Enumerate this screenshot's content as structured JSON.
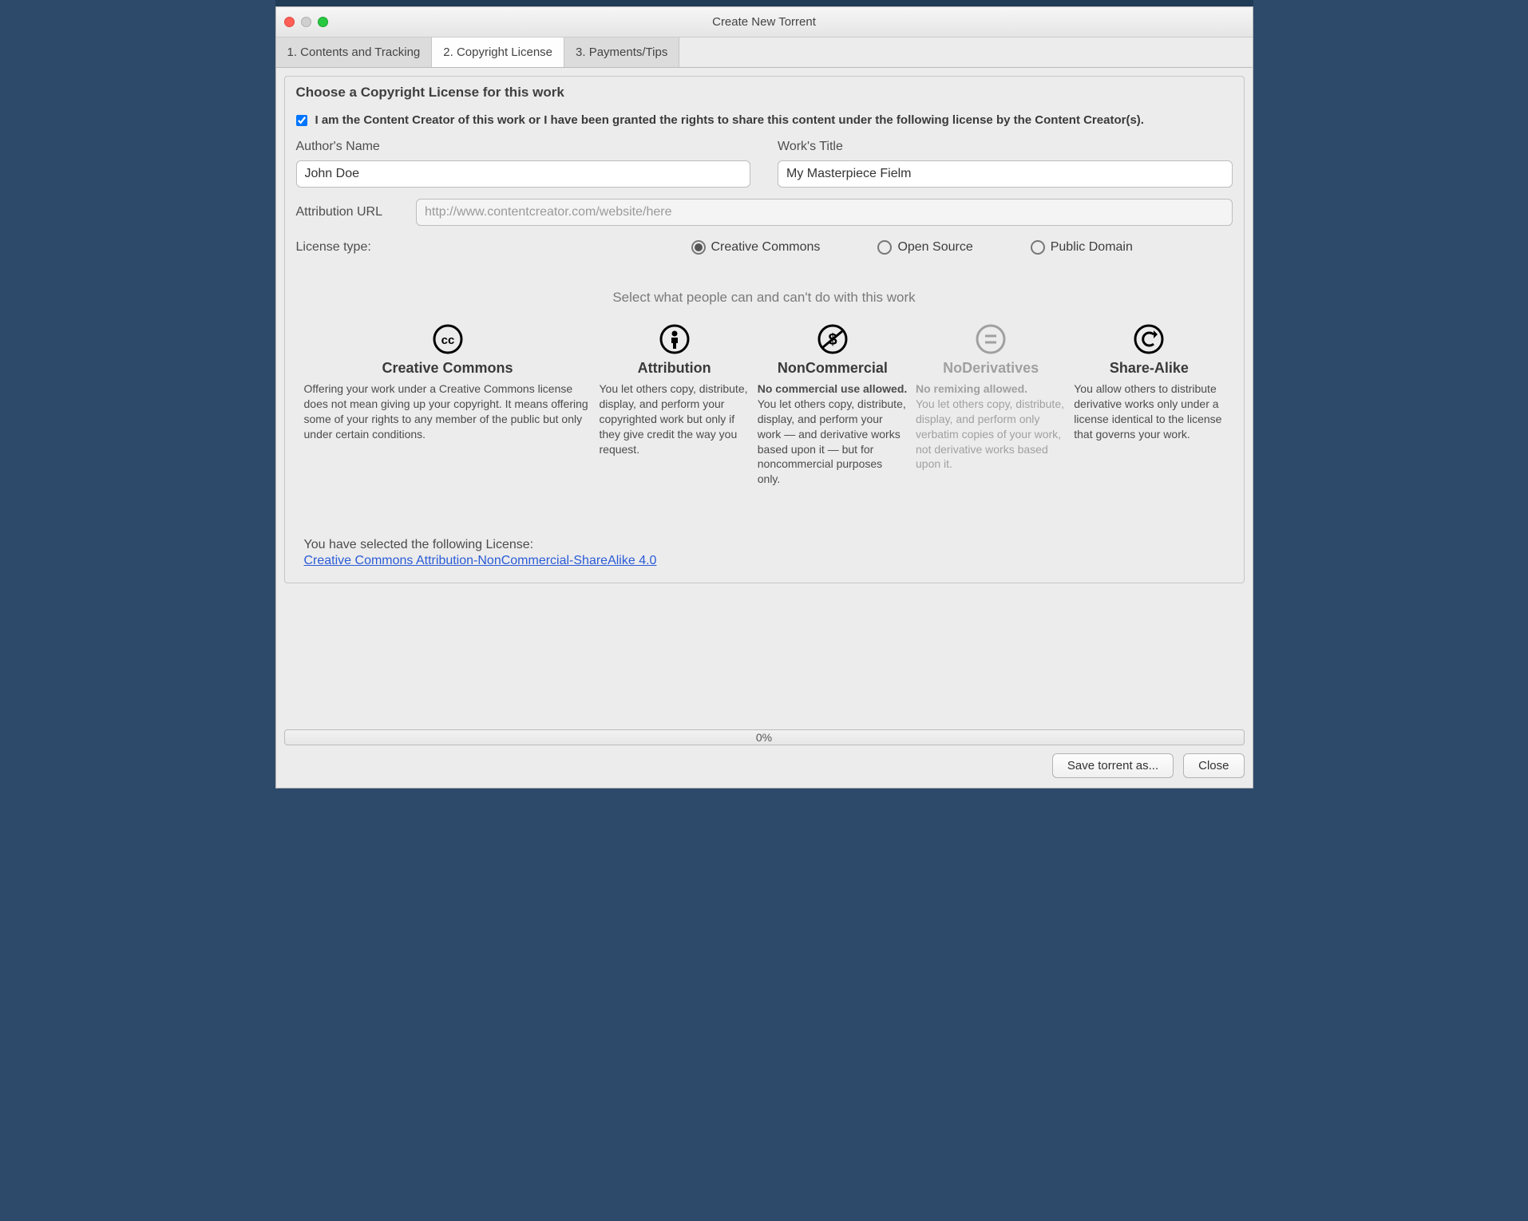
{
  "title": "Create New Torrent",
  "tabs": [
    {
      "label": "1. Contents and Tracking"
    },
    {
      "label": "2. Copyright License"
    },
    {
      "label": "3. Payments/Tips"
    }
  ],
  "panel": {
    "heading": "Choose a Copyright License for this work",
    "consent_label": "I am the Content Creator of this work or I have been granted the rights to share this content under the following license by the Content Creator(s).",
    "author_label": "Author's Name",
    "author_value": "John Doe",
    "work_label": "Work's Title",
    "work_value": "My Masterpiece Fielm",
    "attr_url_label": "Attribution URL",
    "attr_url_placeholder": "http://www.contentcreator.com/website/here",
    "license_type_label": "License type:",
    "radios": {
      "cc": "Creative Commons",
      "os": "Open Source",
      "pd": "Public Domain"
    },
    "section_caption": "Select what people can and can't do with this work",
    "options": {
      "cc": {
        "title": "Creative Commons",
        "desc": "Offering your work under a Creative Commons license does not mean giving up your copyright. It means offering some of your rights to any member of the public but only under certain conditions."
      },
      "attribution": {
        "title": "Attribution",
        "desc": "You let others copy, distribute, display, and perform your copyrighted work but only if they give credit the way you request."
      },
      "noncommercial": {
        "title": "NonCommercial",
        "bold": "No commercial use allowed.",
        "desc": "You let others copy, distribute, display, and perform your work — and derivative works based upon it — but for noncommercial purposes only."
      },
      "noderivatives": {
        "title": "NoDerivatives",
        "bold": "No remixing allowed.",
        "desc": "You let others copy, distribute, display, and perform only verbatim copies of your work, not derivative works based upon it."
      },
      "sharealike": {
        "title": "Share-Alike",
        "desc": "You allow others to distribute derivative works only under a license identical to the license that governs your work."
      }
    },
    "selected_label": "You have selected the following License:",
    "selected_link": "Creative Commons Attribution-NonCommercial-ShareAlike 4.0"
  },
  "progress_text": "0%",
  "buttons": {
    "save": "Save torrent as...",
    "close": "Close"
  }
}
